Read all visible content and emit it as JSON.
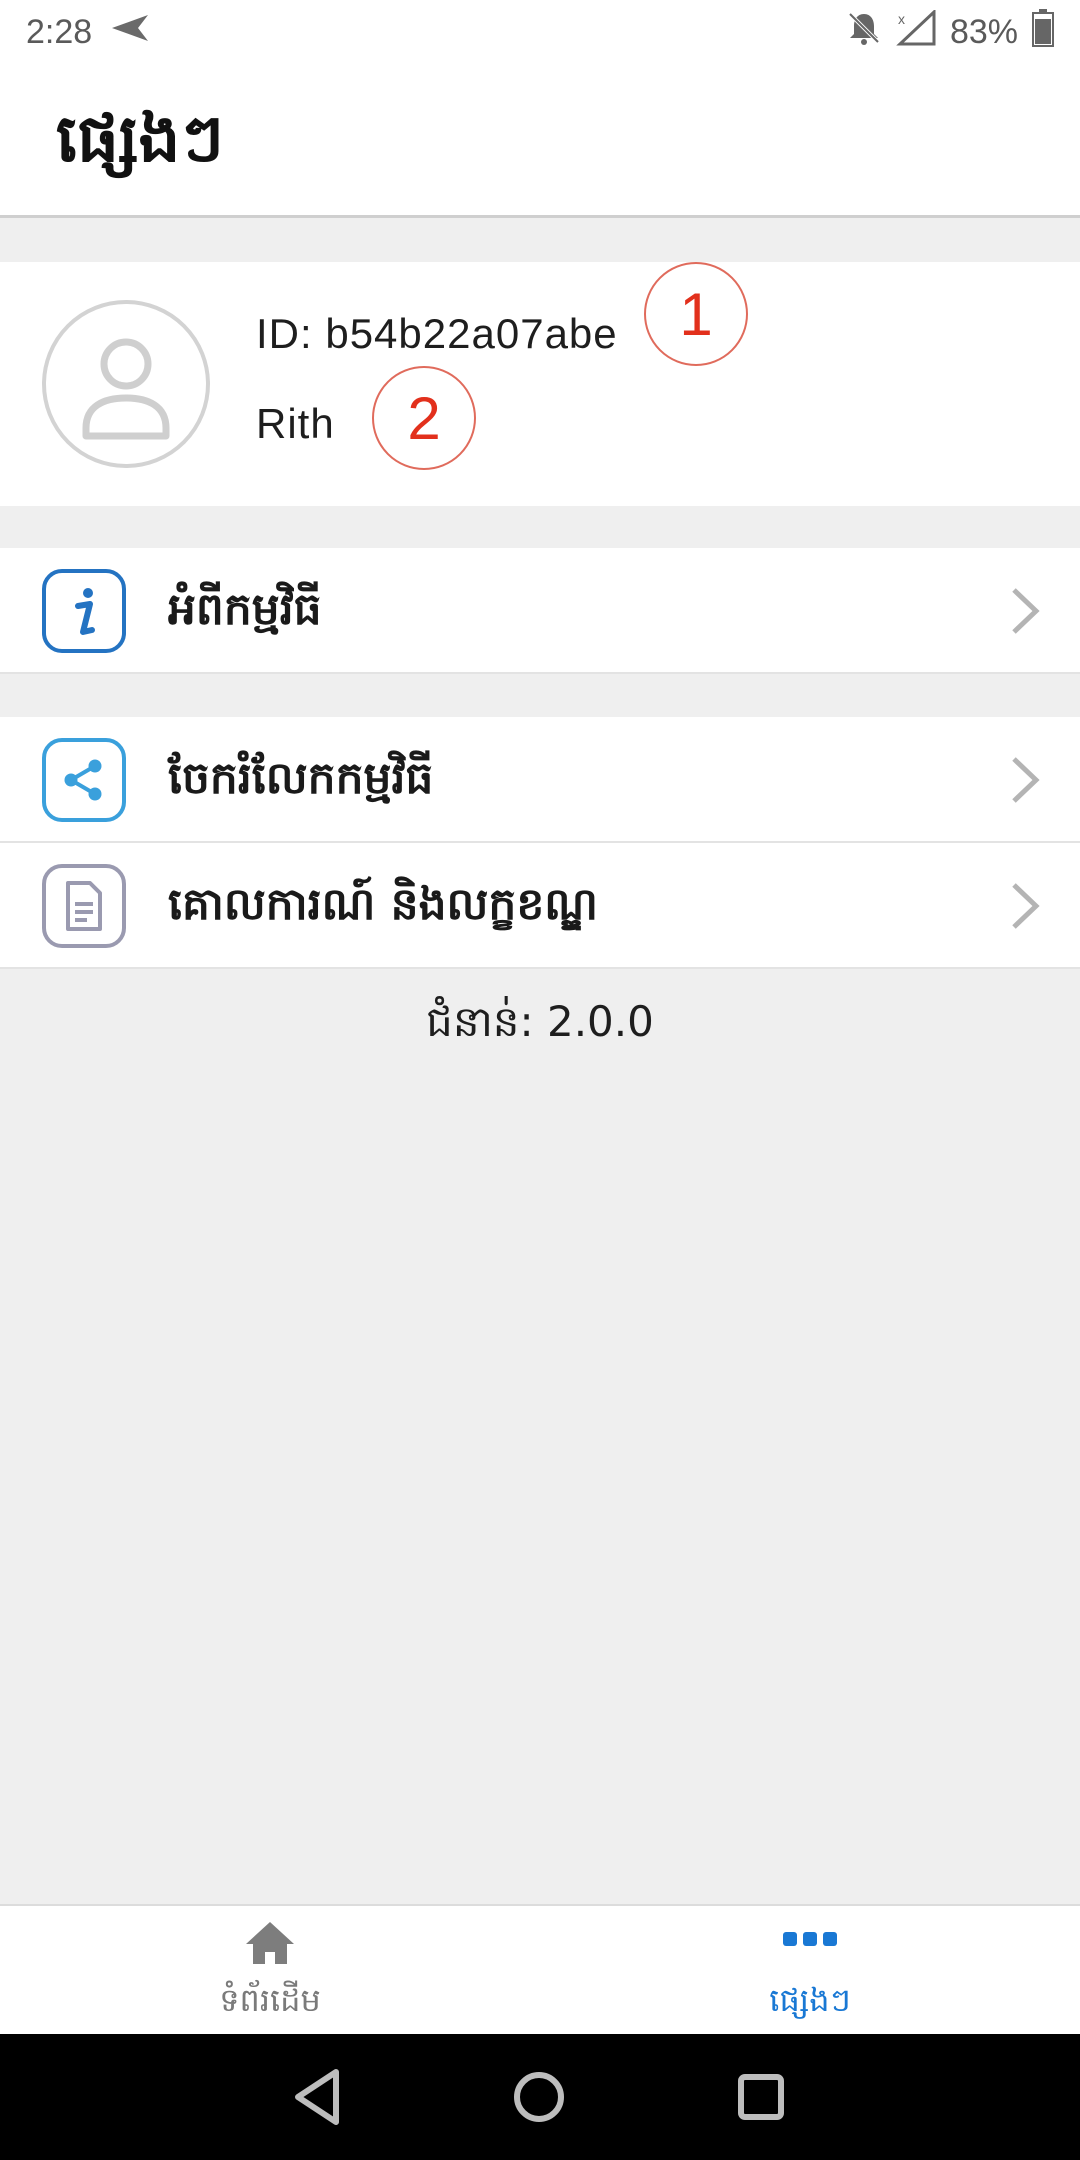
{
  "status_bar": {
    "time": "2:28",
    "battery_percent": "83%",
    "icons": [
      "send-icon",
      "bell-off-icon",
      "no-signal-icon",
      "battery-icon"
    ]
  },
  "header": {
    "title": "ផ្សេងៗ"
  },
  "profile": {
    "id_text": "ID: b54b22a07abe",
    "name": "Rith",
    "annotations": [
      "1",
      "2"
    ]
  },
  "menu": [
    {
      "label": "អំពីកម្មវិធី",
      "icon": "info-icon",
      "color": "#2473c2"
    },
    {
      "label": "ចែករំលែកកម្មវិធី",
      "icon": "share-icon",
      "color": "#3aa0dc"
    },
    {
      "label": "គោលការណ៍ និងលក្ខខណ្ឌ",
      "icon": "document-icon",
      "color": "#9a9ab0"
    }
  ],
  "version": "ជំនាន់: 2.0.0",
  "bottom_nav": {
    "tabs": [
      {
        "label": "ទំព័រដើម",
        "icon": "home-icon",
        "active": false
      },
      {
        "label": "ផ្សេងៗ",
        "icon": "more-icon",
        "active": true
      }
    ],
    "active_color": "#1978d4"
  },
  "system_nav": [
    "back-icon",
    "home-circle-icon",
    "recents-icon"
  ]
}
